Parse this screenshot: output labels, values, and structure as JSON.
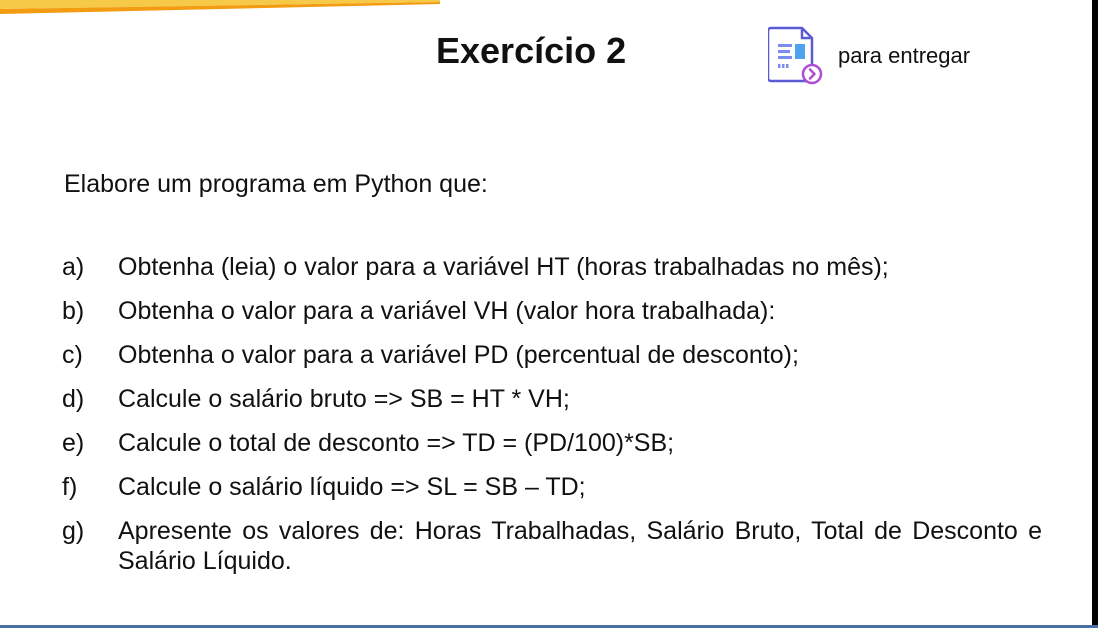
{
  "header": {
    "title": "Exercício 2",
    "deliver_label": "para entregar",
    "icon": "assignment-document-icon"
  },
  "intro": "Elabore um programa em Python que:",
  "tasks": [
    {
      "letter": "a)",
      "text": "Obtenha (leia) o valor para a variável HT (horas trabalhadas no mês);"
    },
    {
      "letter": "b)",
      "text": "Obtenha o valor para a variável VH (valor hora trabalhada):"
    },
    {
      "letter": "c)",
      "text": "Obtenha o valor para a variável PD (percentual de desconto);"
    },
    {
      "letter": "d)",
      "text": "Calcule o salário bruto  =>   SB = HT * VH;"
    },
    {
      "letter": "e)",
      "text": "Calcule o total de desconto  =>   TD = (PD/100)*SB;"
    },
    {
      "letter": "f)",
      "text": "Calcule o salário líquido  =>   SL = SB – TD;"
    },
    {
      "letter": "g)",
      "text": "Apresente os valores de: Horas Trabalhadas, Salário Bruto, Total de Desconto e Salário Líquido."
    }
  ],
  "colors": {
    "accent_orange": "#f39c12",
    "accent_yellow": "#f7c948",
    "icon_blue": "#4a6cf7",
    "icon_purple": "#8e44ad",
    "bottom_border": "#4a6fa5"
  }
}
